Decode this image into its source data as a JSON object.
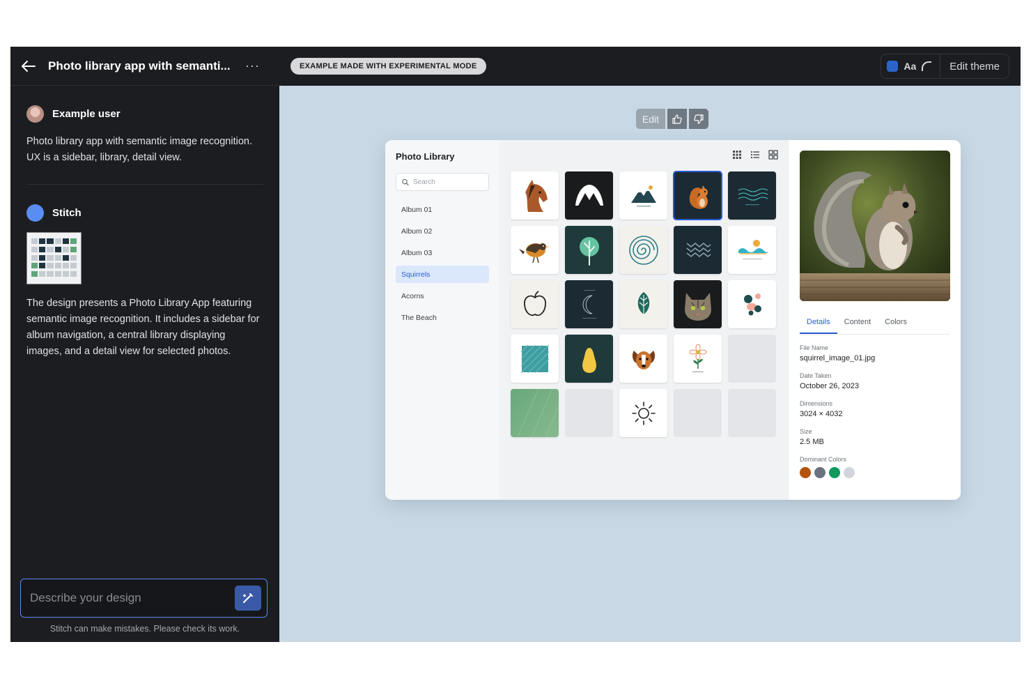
{
  "chat": {
    "title": "Photo library app with semanti...",
    "more_label": "···",
    "user": {
      "name": "Example user",
      "message": "Photo library app with semantic image recognition. UX is a sidebar, library, detail view."
    },
    "assistant": {
      "name": "Stitch",
      "message": "The design presents a Photo Library App featuring semantic image recognition. It includes a sidebar for album navigation, a central library displaying images, and a detail view for selected photos."
    },
    "composer_placeholder": "Describe your design",
    "disclaimer": "Stitch can make mistakes. Please check its work."
  },
  "topbar": {
    "badge": "EXAMPLE MADE WITH EXPERIMENTAL MODE",
    "font_label": "Aa",
    "edit_theme": "Edit theme",
    "theme_color": "#2b63c8"
  },
  "toolbar": {
    "edit_label": "Edit"
  },
  "library": {
    "title": "Photo Library",
    "search_placeholder": "Search",
    "albums": [
      "Album 01",
      "Album 02",
      "Album 03",
      "Squirrels",
      "Acorns",
      "The Beach"
    ],
    "active_album": "Squirrels",
    "tiles": [
      "horse-icon",
      "mountain-arch-icon",
      "mountain-icon",
      "squirrel-icon",
      "waves-icon",
      "bird-icon",
      "tree-icon",
      "spiral-icon",
      "zigzag-icon",
      "beach-icon",
      "apple-icon",
      "moon-icon",
      "leaf-icon",
      "cat-icon",
      "abstract-shapes-icon",
      "texture-icon",
      "pear-icon",
      "dog-icon",
      "flower-icon",
      "placeholder",
      "green-texture",
      "placeholder",
      "sun-icon",
      "placeholder",
      "placeholder"
    ]
  },
  "detail": {
    "tabs": [
      "Details",
      "Content",
      "Colors"
    ],
    "file_name_label": "File Name",
    "file_name": "squirrel_image_01.jpg",
    "date_label": "Date Taken",
    "date": "October 26, 2023",
    "dimensions_label": "Dimensions",
    "dimensions": "3024 × 4032",
    "size_label": "Size",
    "size": "2.5 MB",
    "colors_label": "Dominant Colors",
    "dominant_colors": [
      "#b4530f",
      "#6b7280",
      "#0e9a5e",
      "#d1d5db"
    ]
  }
}
